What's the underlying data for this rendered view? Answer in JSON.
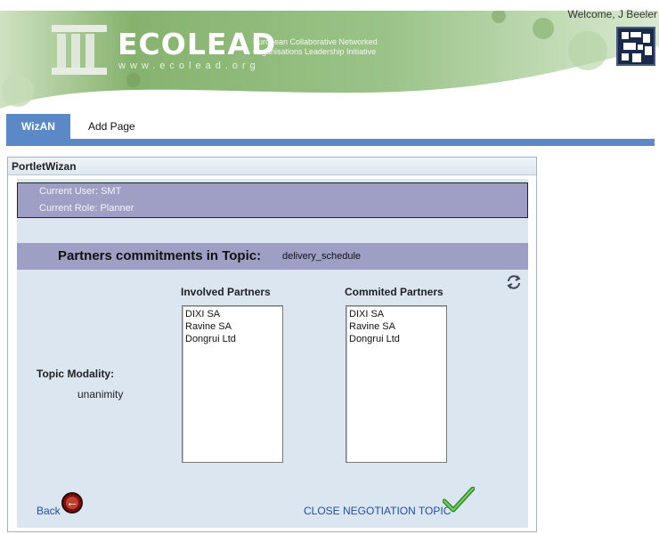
{
  "header": {
    "welcome": "Welcome, J Beeler",
    "logo_title": "ECOLEAD",
    "logo_url": "www.ecolead.org",
    "logo_tagline_1": "European Collaborative Networked",
    "logo_tagline_2": "Organisations Leadership Initiative"
  },
  "tabs": [
    {
      "label": "WizAN",
      "active": true
    },
    {
      "label": "Add Page",
      "active": false
    }
  ],
  "portlet": {
    "title": "PortletWizan",
    "current_user": "Current User: SMT",
    "current_role": "Current Role: Planner",
    "topic_label": "Partners commitments in Topic:",
    "topic_value": "delivery_schedule",
    "involved_header": "Involved Partners",
    "involved_partners": [
      "DIXI SA",
      "Ravine SA",
      "Dongrui Ltd"
    ],
    "committed_header": "Commited Partners",
    "committed_partners": [
      "DIXI SA",
      "Ravine SA",
      "Dongrui Ltd"
    ],
    "modality_label": "Topic Modality:",
    "modality_value": "unanimity",
    "back_label": "Back",
    "close_label": "CLOSE NEGOTIATION TOPIC"
  },
  "icons": {
    "refresh": "refresh-icon",
    "back": "back-arrow-icon",
    "check": "checkmark-icon",
    "grid_logo": "grid-logo-icon"
  },
  "colors": {
    "tab_blue": "#5b89c8",
    "bar_purple": "#9f9fc6",
    "panel_bg": "#dbe6f1",
    "link_blue": "#2050a0",
    "banner_green": "#8fb87a"
  }
}
